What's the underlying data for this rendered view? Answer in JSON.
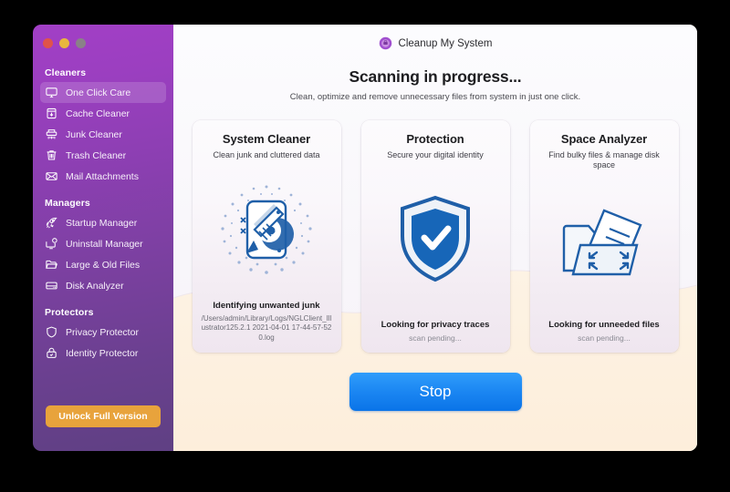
{
  "window": {
    "traffic_lights": [
      "close",
      "minimize",
      "zoom"
    ]
  },
  "app": {
    "title": "Cleanup My System",
    "logo_icon": "cleanup-logo-icon"
  },
  "sidebar": {
    "groups": [
      {
        "label": "Cleaners",
        "items": [
          {
            "label": "One Click Care",
            "icon": "monitor-icon",
            "active": true
          },
          {
            "label": "Cache Cleaner",
            "icon": "cache-box-icon",
            "active": false
          },
          {
            "label": "Junk Cleaner",
            "icon": "shredder-icon",
            "active": false
          },
          {
            "label": "Trash Cleaner",
            "icon": "trash-can-icon",
            "active": false
          },
          {
            "label": "Mail Attachments",
            "icon": "envelope-icon",
            "active": false
          }
        ]
      },
      {
        "label": "Managers",
        "items": [
          {
            "label": "Startup Manager",
            "icon": "rocket-icon",
            "active": false
          },
          {
            "label": "Uninstall Manager",
            "icon": "monitor-badge-icon",
            "active": false
          },
          {
            "label": "Large & Old Files",
            "icon": "folder-icon",
            "active": false
          },
          {
            "label": "Disk Analyzer",
            "icon": "hard-drive-icon",
            "active": false
          }
        ]
      },
      {
        "label": "Protectors",
        "items": [
          {
            "label": "Privacy Protector",
            "icon": "shield-icon",
            "active": false
          },
          {
            "label": "Identity Protector",
            "icon": "lock-icon",
            "active": false
          }
        ]
      }
    ],
    "unlock_button": "Unlock Full Version"
  },
  "main": {
    "headline": "Scanning in progress...",
    "subline": "Clean, optimize and remove unnecessary files from system in just one click.",
    "cards": [
      {
        "title": "System Cleaner",
        "subtitle": "Clean junk and cluttered data",
        "icon": "broom-disk-scan-icon",
        "status": "Identifying unwanted junk",
        "detail": "/Users/admin/Library/Logs/NGLClient_Illustrator125.2.1 2021-04-01 17-44-57-520.log",
        "pending": false
      },
      {
        "title": "Protection",
        "subtitle": "Secure your digital identity",
        "icon": "shield-check-icon",
        "status": "Looking for privacy traces",
        "detail": "scan pending...",
        "pending": true
      },
      {
        "title": "Space Analyzer",
        "subtitle": "Find bulky files & manage disk space",
        "icon": "folder-expand-icon",
        "status": "Looking for unneeded files",
        "detail": "scan pending...",
        "pending": true
      }
    ],
    "stop_button": "Stop"
  },
  "colors": {
    "sidebar_top": "#a23fc6",
    "sidebar_bottom": "#5f4083",
    "accent_blue": "#1b86f2",
    "unlock_orange": "#e8a33c",
    "icon_blue": "#1f5fa8",
    "canvas_top": "#fbfbfd",
    "canvas_bottom": "#fdefdc"
  }
}
